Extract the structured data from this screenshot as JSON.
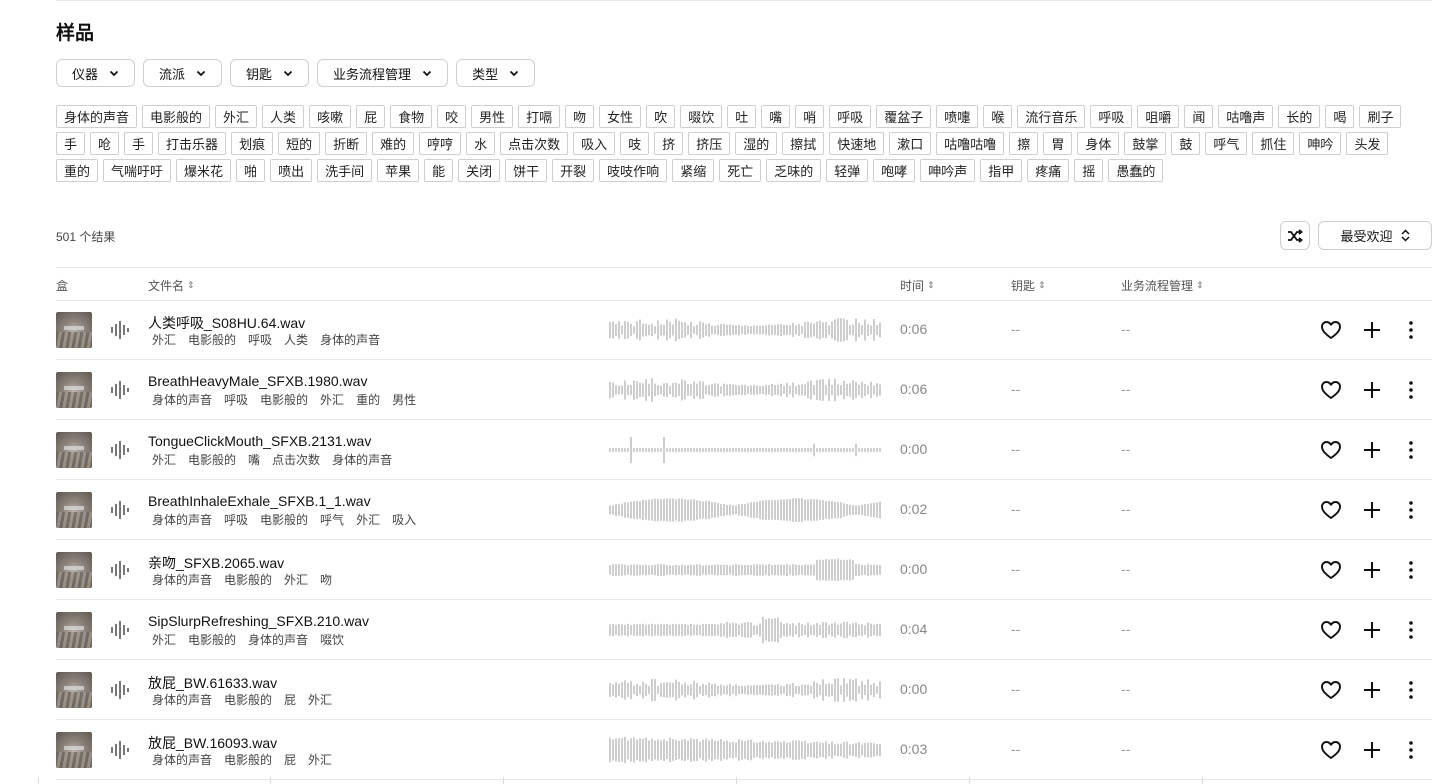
{
  "page_title": "样品",
  "filters": [
    {
      "label": "仪器"
    },
    {
      "label": "流派"
    },
    {
      "label": "钥匙"
    },
    {
      "label": "业务流程管理"
    },
    {
      "label": "类型"
    }
  ],
  "tags": [
    "身体的声音",
    "电影般的",
    "外汇",
    "人类",
    "咳嗽",
    "屁",
    "食物",
    "咬",
    "男性",
    "打嗝",
    "吻",
    "女性",
    "吹",
    "啜饮",
    "吐",
    "嘴",
    "哨",
    "呼吸",
    "覆盆子",
    "喷嚏",
    "喉",
    "流行音乐",
    "呼吸",
    "咀嚼",
    "闻",
    "咕噜声",
    "长的",
    "喝",
    "刷子",
    "手",
    "呛",
    "手",
    "打击乐器",
    "划痕",
    "短的",
    "折断",
    "难的",
    "哼哼",
    "水",
    "点击次数",
    "吸入",
    "吱",
    "挤",
    "挤压",
    "湿的",
    "擦拭",
    "快速地",
    "漱口",
    "咕噜咕噜",
    "擦",
    "胃",
    "身体",
    "鼓掌",
    "鼓",
    "呼气",
    "抓住",
    "呻吟",
    "头发",
    "重的",
    "气喘吁吁",
    "爆米花",
    "啪",
    "喷出",
    "洗手间",
    "苹果",
    "能",
    "关闭",
    "饼干",
    "开裂",
    "吱吱作响",
    "紧缩",
    "死亡",
    "乏味的",
    "轻弹",
    "咆哮",
    "呻吟声",
    "指甲",
    "疼痛",
    "摇",
    "愚蠢的"
  ],
  "results_count": "501 个结果",
  "sort": {
    "label": "最受欢迎"
  },
  "columns": {
    "pack": "盒",
    "filename": "文件名",
    "time": "时间",
    "key": "钥匙",
    "bpm": "业务流程管理"
  },
  "rows": [
    {
      "filename": "人类呼吸_S08HU.64.wav",
      "tags": [
        "外汇",
        "电影般的",
        "呼吸",
        "人类",
        "身体的声音"
      ],
      "time": "0:06",
      "key": "--",
      "bpm": "--",
      "wave_profile": "breath1"
    },
    {
      "filename": "BreathHeavyMale_SFXB.1980.wav",
      "tags": [
        "身体的声音",
        "呼吸",
        "电影般的",
        "外汇",
        "重的",
        "男性"
      ],
      "time": "0:06",
      "key": "--",
      "bpm": "--",
      "wave_profile": "breath2"
    },
    {
      "filename": "TongueClickMouth_SFXB.2131.wav",
      "tags": [
        "外汇",
        "电影般的",
        "嘴",
        "点击次数",
        "身体的声音"
      ],
      "time": "0:00",
      "key": "--",
      "bpm": "--",
      "wave_profile": "clicks"
    },
    {
      "filename": "BreathInhaleExhale_SFXB.1_1.wav",
      "tags": [
        "身体的声音",
        "呼吸",
        "电影般的",
        "呼气",
        "外汇",
        "吸入"
      ],
      "time": "0:02",
      "key": "--",
      "bpm": "--",
      "wave_profile": "inhale"
    },
    {
      "filename": "亲吻_SFXB.2065.wav",
      "tags": [
        "身体的声音",
        "电影般的",
        "外汇",
        "吻"
      ],
      "time": "0:00",
      "key": "--",
      "bpm": "--",
      "wave_profile": "kiss"
    },
    {
      "filename": "SipSlurpRefreshing_SFXB.210.wav",
      "tags": [
        "外汇",
        "电影般的",
        "身体的声音",
        "啜饮"
      ],
      "time": "0:04",
      "key": "--",
      "bpm": "--",
      "wave_profile": "sip"
    },
    {
      "filename": "放屁_BW.61633.wav",
      "tags": [
        "身体的声音",
        "电影般的",
        "屁",
        "外汇"
      ],
      "time": "0:00",
      "key": "--",
      "bpm": "--",
      "wave_profile": "fart1"
    },
    {
      "filename": "放屁_BW.16093.wav",
      "tags": [
        "身体的声音",
        "电影般的",
        "屁",
        "外汇"
      ],
      "time": "0:03",
      "key": "--",
      "bpm": "--",
      "wave_profile": "fart2"
    }
  ],
  "icons": {
    "chevron": "chevron-down-icon",
    "shuffle": "shuffle-icon",
    "sort": "sort-updown-icon",
    "play": "waveform-play-icon",
    "favorite": "heart-icon",
    "add": "plus-icon",
    "more": "more-vertical-icon"
  },
  "colors": {
    "waveform": "#b8b8b8",
    "border": "#cfcfcf",
    "muted": "#888888"
  }
}
